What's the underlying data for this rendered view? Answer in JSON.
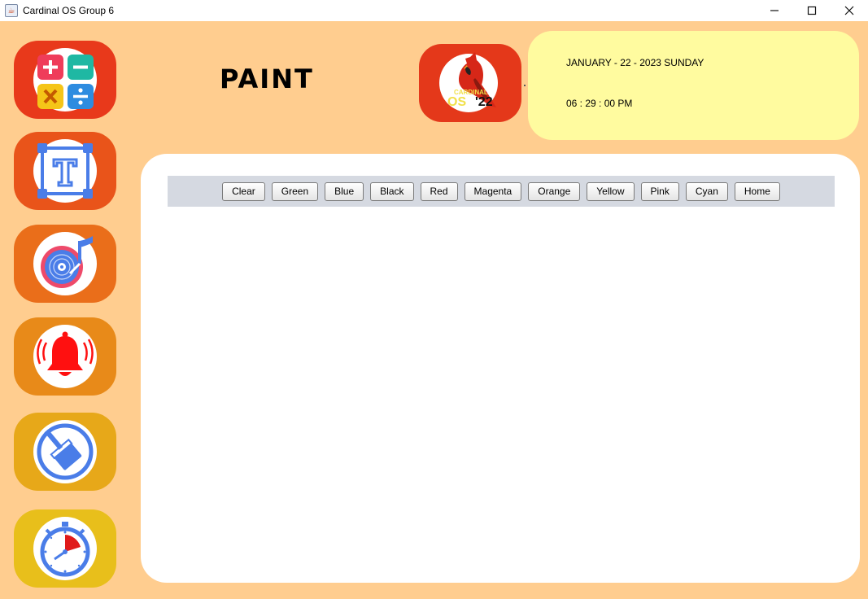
{
  "window": {
    "title": "Cardinal OS Group 6",
    "icon": "java-icon",
    "controls": {
      "minimize": "—",
      "maximize": "☐",
      "close": "✕"
    }
  },
  "sidebar": {
    "items": [
      {
        "name": "calculator",
        "icon": "calculator-icon",
        "color": "#e8391b"
      },
      {
        "name": "text-editor",
        "icon": "text-editor-icon",
        "color": "#e9541a"
      },
      {
        "name": "music",
        "icon": "music-icon",
        "color": "#ea6e1a"
      },
      {
        "name": "alarm",
        "icon": "alarm-bell-icon",
        "color": "#e88a19"
      },
      {
        "name": "paint",
        "icon": "paint-brush-icon",
        "color": "#e7a819"
      },
      {
        "name": "timer",
        "icon": "stopwatch-icon",
        "color": "#e8bf1b"
      }
    ]
  },
  "header": {
    "app_title": "PAINT",
    "logo": {
      "icon": "cardinal-logo-icon",
      "text_top": "CARDINAL",
      "text_os": "OS",
      "text_year": "'22"
    }
  },
  "datetime": {
    "date": "JANUARY - 22 - 2023 SUNDAY",
    "time": "06 : 29 : 00 PM"
  },
  "toolbar": {
    "buttons": [
      "Clear",
      "Green",
      "Blue",
      "Black",
      "Red",
      "Magenta",
      "Orange",
      "Yellow",
      "Pink",
      "Cyan",
      "Home"
    ]
  },
  "colors": {
    "background": "#ffcd8f",
    "datetime_bg": "#fffb9f",
    "toolbar_bg": "#d5d9e1",
    "logo_bg": "#e4381a"
  }
}
